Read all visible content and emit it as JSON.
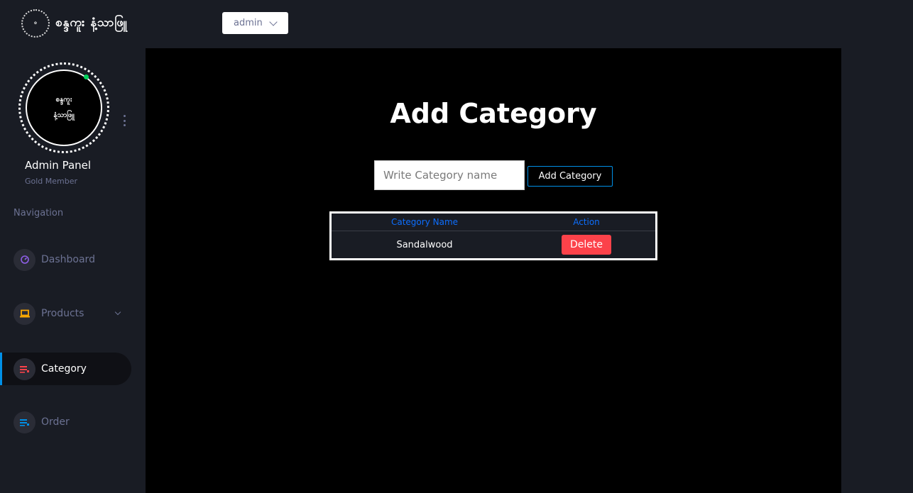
{
  "brand": {
    "logo_text": "",
    "name": "စန္ဒကူး နံ့သာဖြူ"
  },
  "header": {
    "user_select_value": "admin"
  },
  "profile": {
    "avatar_line1": "စန္ဒကူး",
    "avatar_line2": "နံ့သာဖြူ",
    "name": "Admin Panel",
    "level": "Gold Member"
  },
  "nav": {
    "caption": "Navigation",
    "items": [
      {
        "label": "Dashboard",
        "icon": "speedometer-icon",
        "color": "#8f5fe8"
      },
      {
        "label": "Products",
        "icon": "laptop-icon",
        "color": "#ffab00"
      },
      {
        "label": "Category",
        "icon": "playlist-icon",
        "color": "#fc424a",
        "active": true
      },
      {
        "label": "Order",
        "icon": "list-icon",
        "color": "#0090e7"
      }
    ]
  },
  "main": {
    "title": "Add Category",
    "input_placeholder": "Write Category name",
    "add_button": "Add Category",
    "table": {
      "headers": [
        "Category Name",
        "Action"
      ],
      "rows": [
        {
          "name": "Sandalwood",
          "action": "Delete"
        }
      ]
    }
  },
  "colors": {
    "accent": "#0090e7",
    "danger": "#fc424a",
    "online": "#00d25b",
    "header_link": "#0d6efd"
  }
}
